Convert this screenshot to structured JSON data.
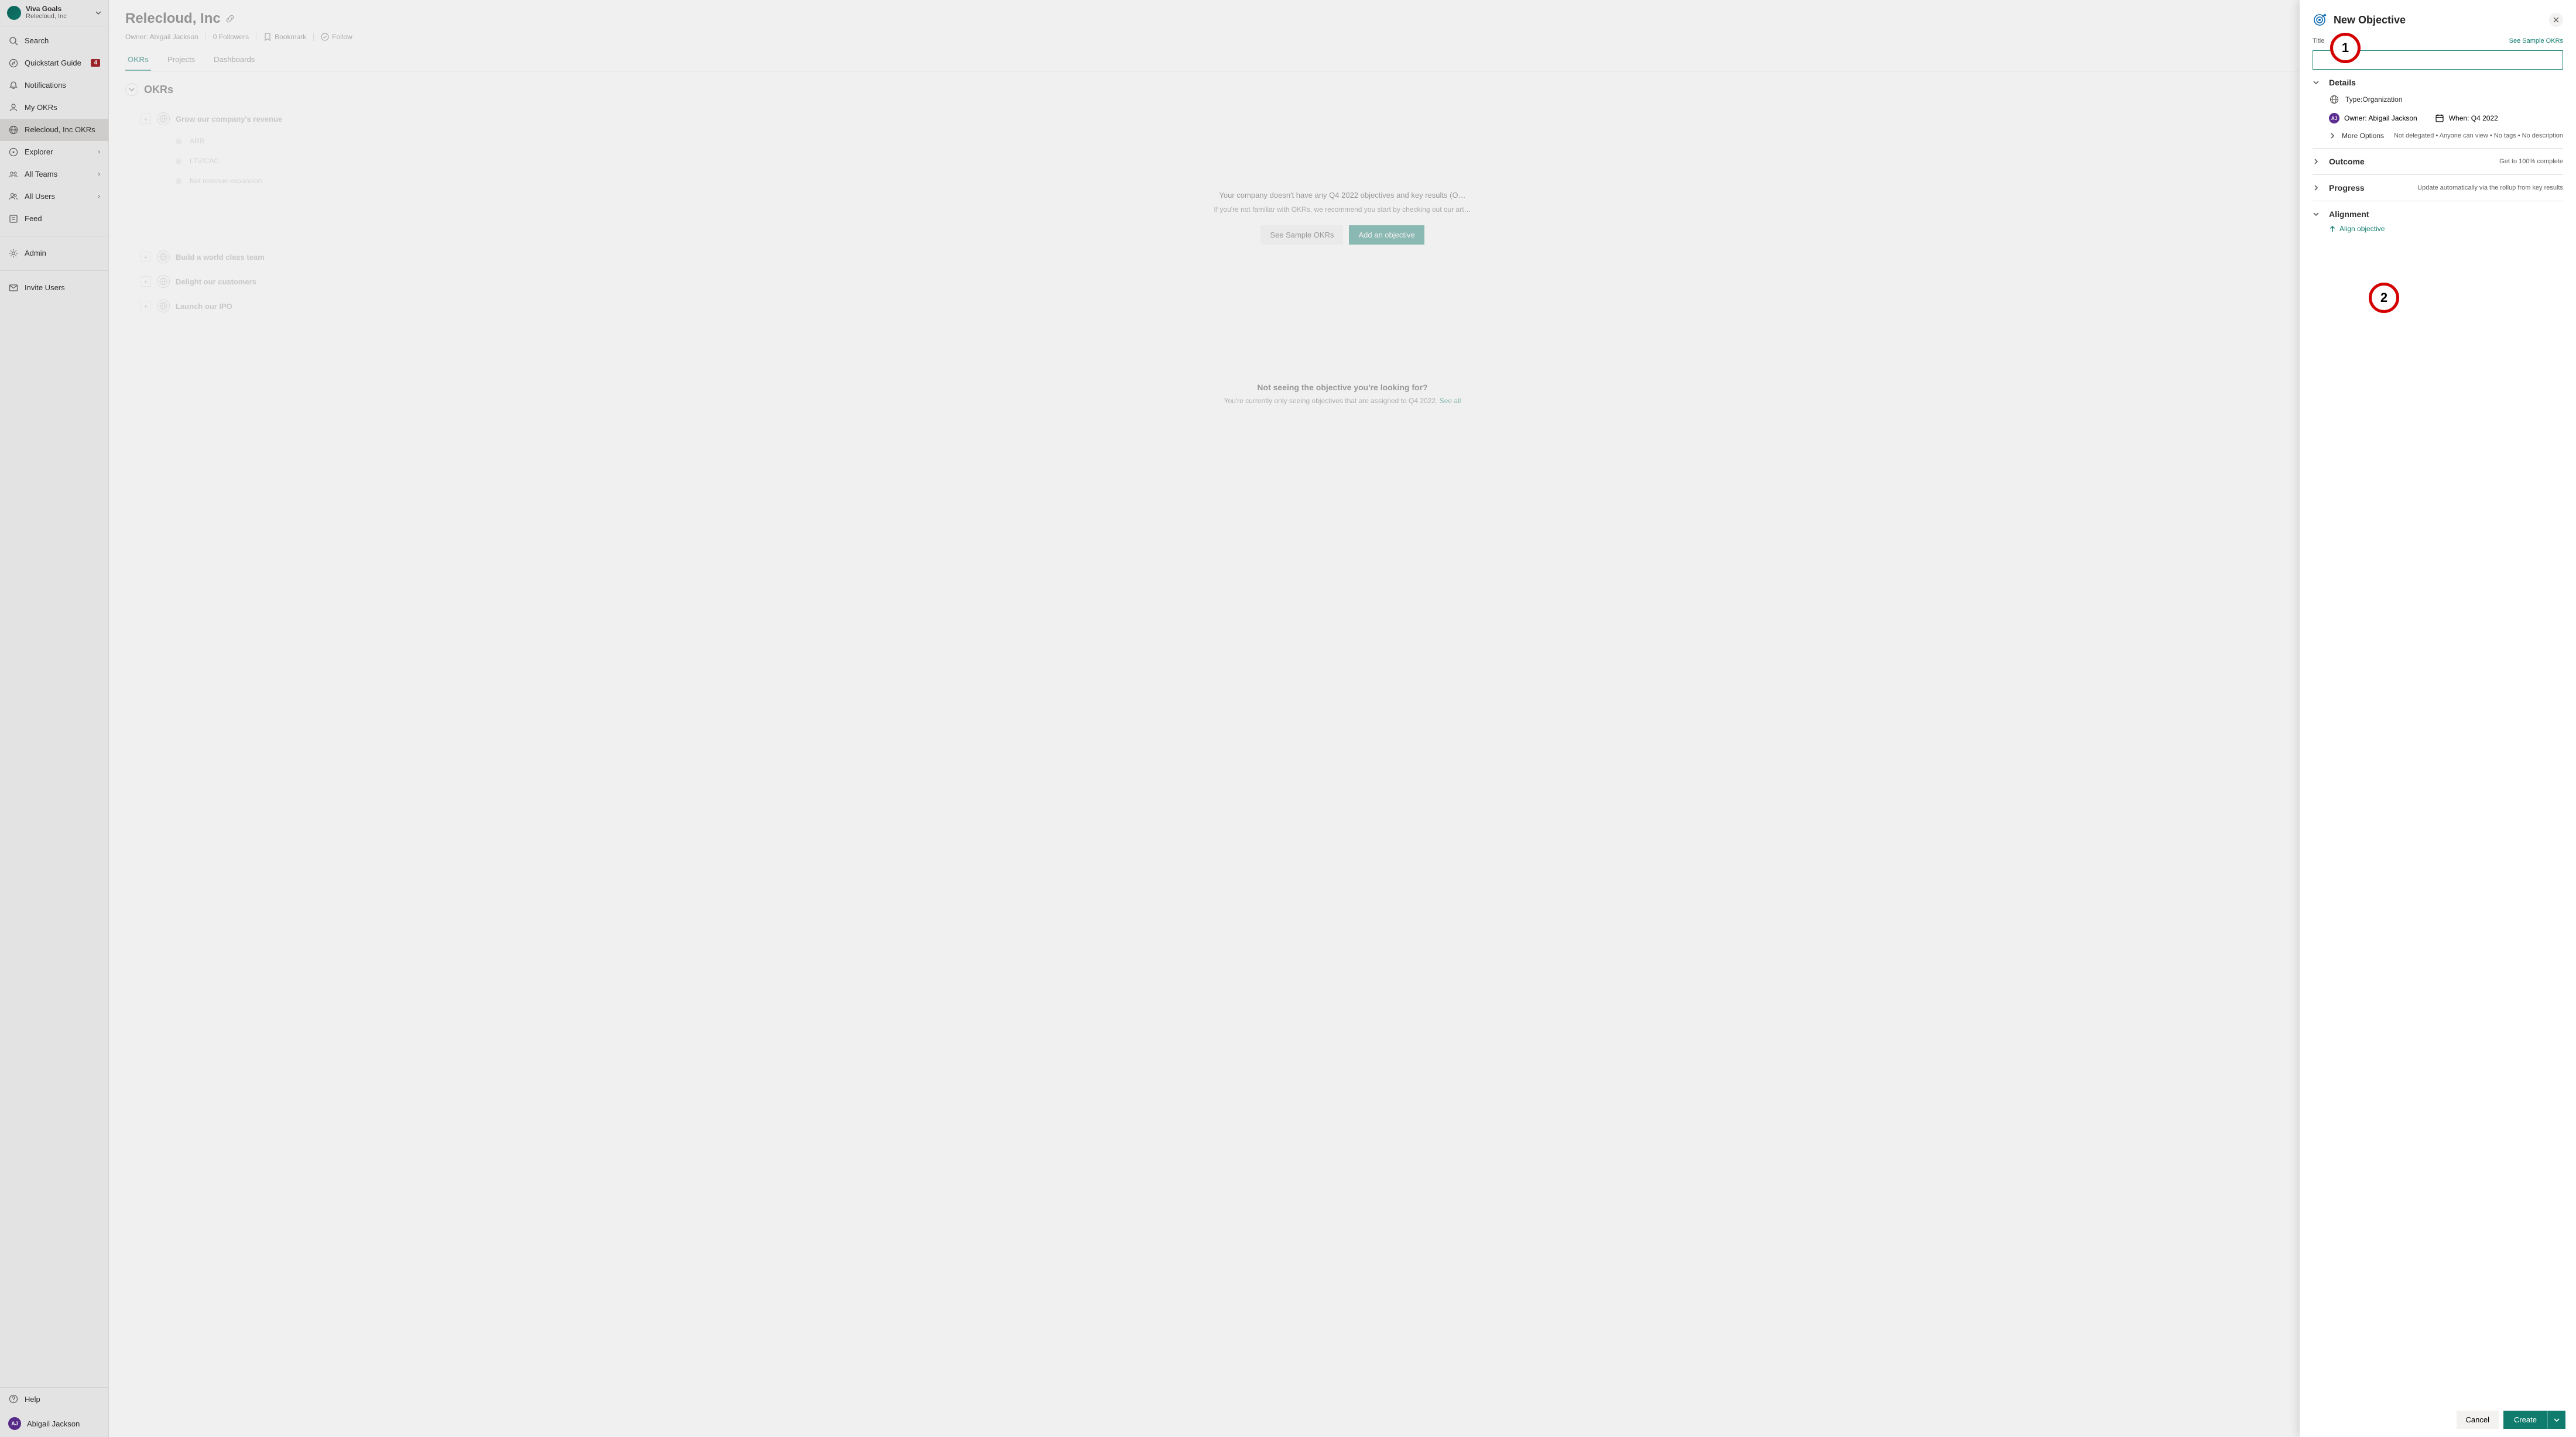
{
  "brand": {
    "title": "Viva Goals",
    "subtitle": "Relecloud, Inc"
  },
  "sidebar": {
    "search": "Search",
    "quickstart": "Quickstart Guide",
    "quickstart_badge": "4",
    "notifications": "Notifications",
    "my_okrs": "My OKRs",
    "org_okrs": "Relecloud, Inc OKRs",
    "explorer": "Explorer",
    "all_teams": "All Teams",
    "all_users": "All Users",
    "feed": "Feed",
    "admin": "Admin",
    "invite": "Invite Users",
    "help": "Help",
    "user": "Abigail Jackson",
    "user_initials": "AJ"
  },
  "header": {
    "page_title": "Relecloud, Inc",
    "owner": "Owner: Abigail Jackson",
    "followers": "0 Followers",
    "bookmark": "Bookmark",
    "follow": "Follow"
  },
  "tabs": {
    "okrs": "OKRs",
    "projects": "Projects",
    "dashboards": "Dashboards"
  },
  "okrs": {
    "heading": "OKRs",
    "objectives": [
      {
        "title": "Grow our company's revenue",
        "krs": [
          "ARR",
          "LTV/CAC",
          "Net revenue expansion"
        ]
      },
      {
        "title": "Build a world class team",
        "krs": []
      },
      {
        "title": "Delight our customers",
        "krs": []
      },
      {
        "title": "Launch our IPO",
        "krs": []
      }
    ],
    "empty_line1": "Your company doesn't have any Q4 2022 objectives and key results (O…",
    "empty_line2": "If you're not familiar with OKRs, we recommend you start by checking out our art…",
    "see_sample": "See Sample OKRs",
    "add_objective": "Add an objective",
    "not_seeing_heading": "Not seeing the objective you're looking for?",
    "not_seeing_text": "You're currently only seeing objectives that are assigned to Q4 2022. ",
    "see_all": "See all"
  },
  "panel": {
    "title": "New Objective",
    "title_label": "Title",
    "sample_link": "See Sample OKRs",
    "details": {
      "heading": "Details",
      "type_label": "Type:",
      "type_value": "Organization",
      "owner": "Owner: Abigail Jackson",
      "owner_initials": "AJ",
      "when_label": "When:",
      "when_value": "Q4 2022",
      "more_options": "More Options",
      "more_hint": "Not delegated • Anyone can view • No tags • No description"
    },
    "outcome": {
      "heading": "Outcome",
      "hint": "Get to 100% complete"
    },
    "progress": {
      "heading": "Progress",
      "hint": "Update automatically via the rollup from key results"
    },
    "alignment": {
      "heading": "Alignment",
      "align_link": "Align objective"
    },
    "cancel": "Cancel",
    "create": "Create"
  },
  "annotations": {
    "one": "1",
    "two": "2"
  }
}
